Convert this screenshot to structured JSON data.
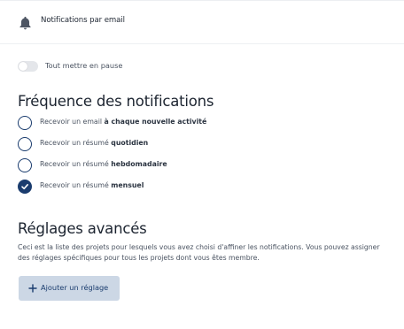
{
  "header": {
    "title": "Notifications par email",
    "icon": "bell-icon"
  },
  "pause_toggle": {
    "label": "Tout mettre en pause",
    "on": false
  },
  "frequency": {
    "heading": "Fréquence des notifications",
    "options": [
      {
        "prefix": "Recevoir un email ",
        "emphasis": "à chaque nouvelle activité",
        "checked": false
      },
      {
        "prefix": "Recevoir un résumé ",
        "emphasis": "quotidien",
        "checked": false
      },
      {
        "prefix": "Recevoir un résumé ",
        "emphasis": "hebdomadaire",
        "checked": false
      },
      {
        "prefix": "Recevoir un résumé ",
        "emphasis": "mensuel",
        "checked": true
      }
    ]
  },
  "advanced": {
    "heading": "Réglages avancés",
    "description": "Ceci est la liste des projets pour lesquels vous avez choisi d'affiner les notifications. Vous pouvez assigner des réglages spécifiques pour tous les projets dont vous êtes membre.",
    "add_button_label": "Ajouter un réglage"
  },
  "colors": {
    "accent": "#1a3c6e",
    "button_bg": "#ccd7e5"
  }
}
